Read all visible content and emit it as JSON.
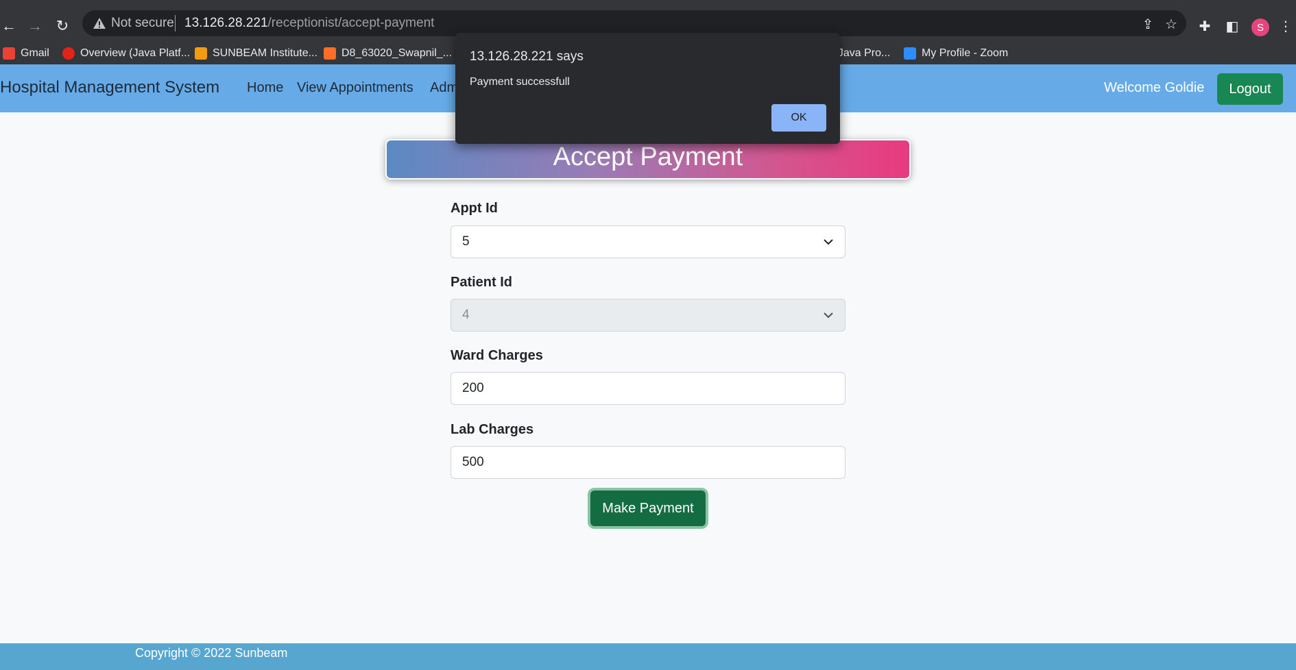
{
  "browser": {
    "security_label": "Not secure",
    "url_host": "13.126.28.221",
    "url_path": "/receptionist/accept-payment",
    "profile_initial": "S",
    "bookmarks": [
      {
        "label": "Gmail",
        "icon": "gmail-icon",
        "color": "#ea4335"
      },
      {
        "label": "Overview (Java Platf...",
        "icon": "oracle-icon",
        "color": "#e2231a"
      },
      {
        "label": "SUNBEAM Institute...",
        "icon": "sunbeam-icon",
        "color": "#f39c12"
      },
      {
        "label": "D8_63020_Swapnil_...",
        "icon": "gitlab-icon",
        "color": "#fc6d26"
      },
      {
        "label": "f Java Pro...",
        "icon": "bookmark-icon",
        "color": "#4285f4"
      },
      {
        "label": "My Profile - Zoom",
        "icon": "zoom-icon",
        "color": "#2d8cff"
      }
    ]
  },
  "app": {
    "brand": "Hospital Management System",
    "nav": [
      "Home",
      "View Appointments",
      "Adm"
    ],
    "welcome": "Welcome Goldie",
    "logout_label": "Logout"
  },
  "form": {
    "title": "Accept Payment",
    "appt_id_label": "Appt Id",
    "appt_id_value": "5",
    "patient_id_label": "Patient Id",
    "patient_id_value": "4",
    "ward_charges_label": "Ward Charges",
    "ward_charges_value": "200",
    "lab_charges_label": "Lab Charges",
    "lab_charges_value": "500",
    "submit_label": "Make Payment"
  },
  "footer": {
    "text": "Copyright © 2022 Sunbeam"
  },
  "dialog": {
    "title": "13.126.28.221 says",
    "message": "Payment successfull",
    "ok_label": "OK"
  },
  "colors": {
    "navbar": "#66abe8",
    "success": "#198754",
    "footer": "#56a6d0",
    "header_gradient_start": "#5b8ac3",
    "header_gradient_end": "#e83a7f"
  }
}
